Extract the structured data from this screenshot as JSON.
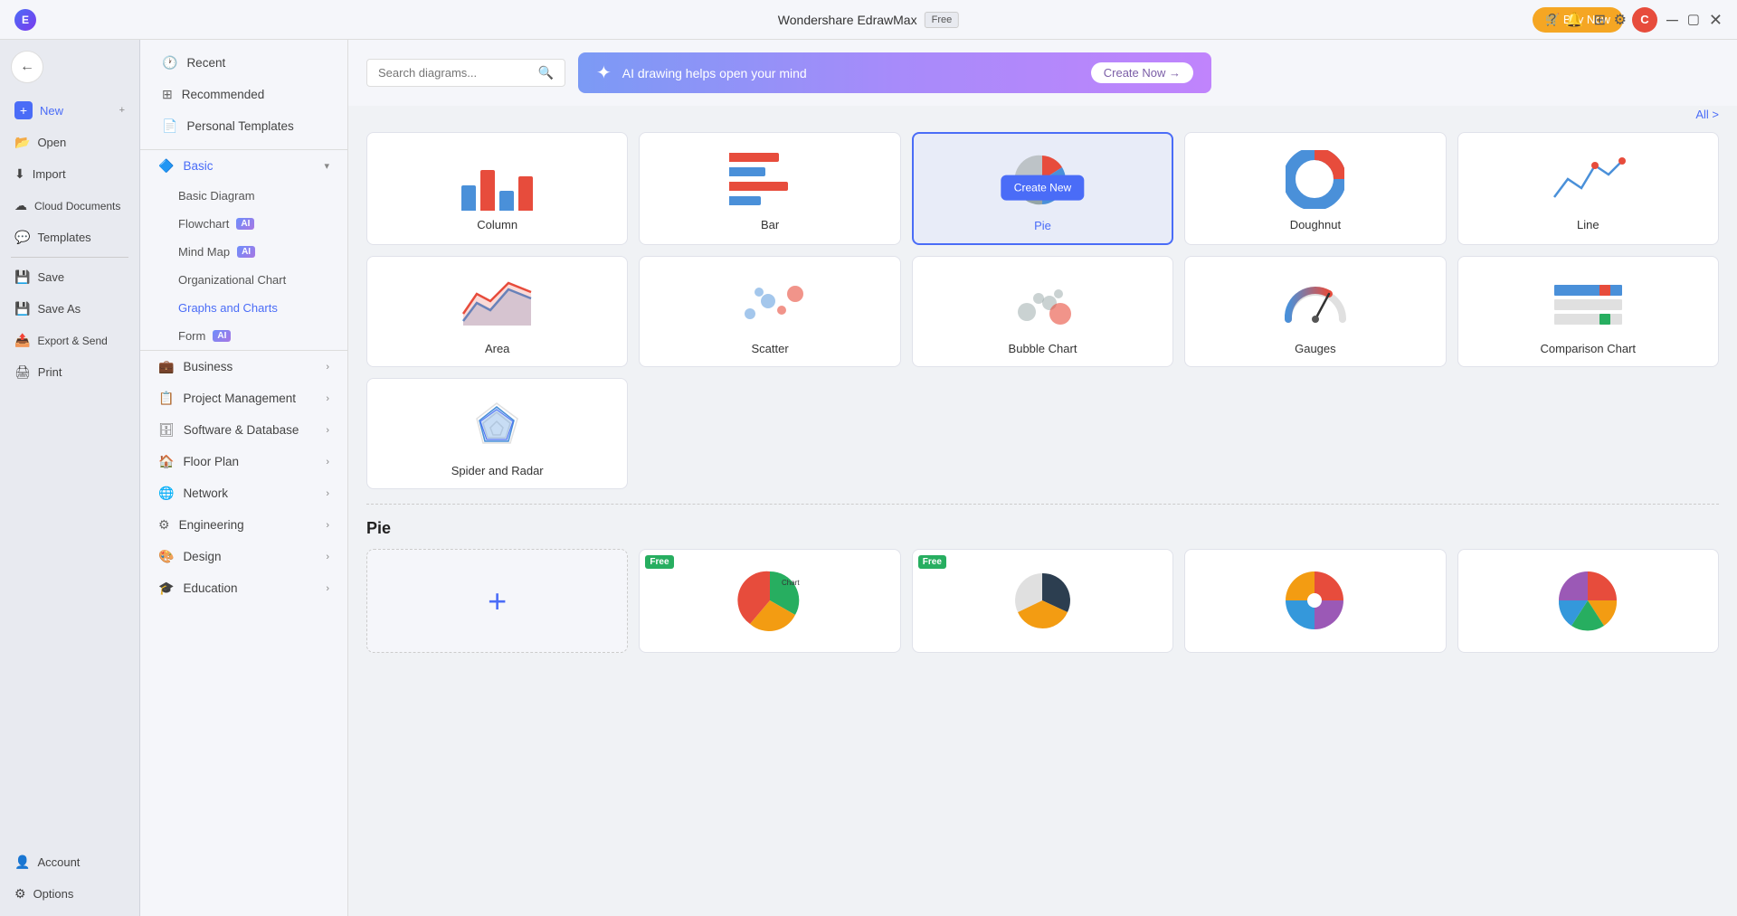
{
  "app": {
    "title": "Wondershare EdrawMax",
    "free_badge": "Free",
    "buy_btn": "Buy Now",
    "user_initial": "C",
    "window_controls": [
      "minimize",
      "maximize",
      "close"
    ]
  },
  "topbar": {
    "search_placeholder": "Search diagrams...",
    "banner_text": "AI drawing helps open your mind",
    "banner_cta": "Create Now →",
    "all_link": "All >"
  },
  "left_nav": {
    "recent": "Recent",
    "recommended": "Recommended",
    "personal_templates": "Personal Templates",
    "basic": "Basic",
    "basic_diagram": "Basic Diagram",
    "flowchart": "Flowchart",
    "mind_map": "Mind Map",
    "org_chart": "Organizational Chart",
    "graphs_charts": "Graphs and Charts",
    "form": "Form",
    "business": "Business",
    "project_management": "Project Management",
    "software_database": "Software & Database",
    "floor_plan": "Floor Plan",
    "network": "Network",
    "engineering": "Engineering",
    "design": "Design",
    "education": "Education"
  },
  "sidebar_nav": {
    "new": "New",
    "open": "Open",
    "import": "Import",
    "cloud_documents": "Cloud Documents",
    "templates": "Templates",
    "save": "Save",
    "save_as": "Save As",
    "export_send": "Export & Send",
    "print": "Print",
    "account": "Account",
    "options": "Options"
  },
  "chart_types": [
    {
      "id": "column",
      "label": "Column",
      "selected": false
    },
    {
      "id": "bar",
      "label": "Bar",
      "selected": false
    },
    {
      "id": "pie",
      "label": "Pie",
      "selected": true
    },
    {
      "id": "doughnut",
      "label": "Doughnut",
      "selected": false
    },
    {
      "id": "line",
      "label": "Line",
      "selected": false
    },
    {
      "id": "area",
      "label": "Area",
      "selected": false
    },
    {
      "id": "scatter",
      "label": "Scatter",
      "selected": false
    },
    {
      "id": "bubble",
      "label": "Bubble Chart",
      "selected": false
    },
    {
      "id": "gauges",
      "label": "Gauges",
      "selected": false
    },
    {
      "id": "comparison",
      "label": "Comparison Chart",
      "selected": false
    },
    {
      "id": "spider",
      "label": "Spider and Radar",
      "selected": false
    }
  ],
  "create_new_label": "Create New",
  "templates_section_title": "Pie",
  "template_add_label": "+"
}
